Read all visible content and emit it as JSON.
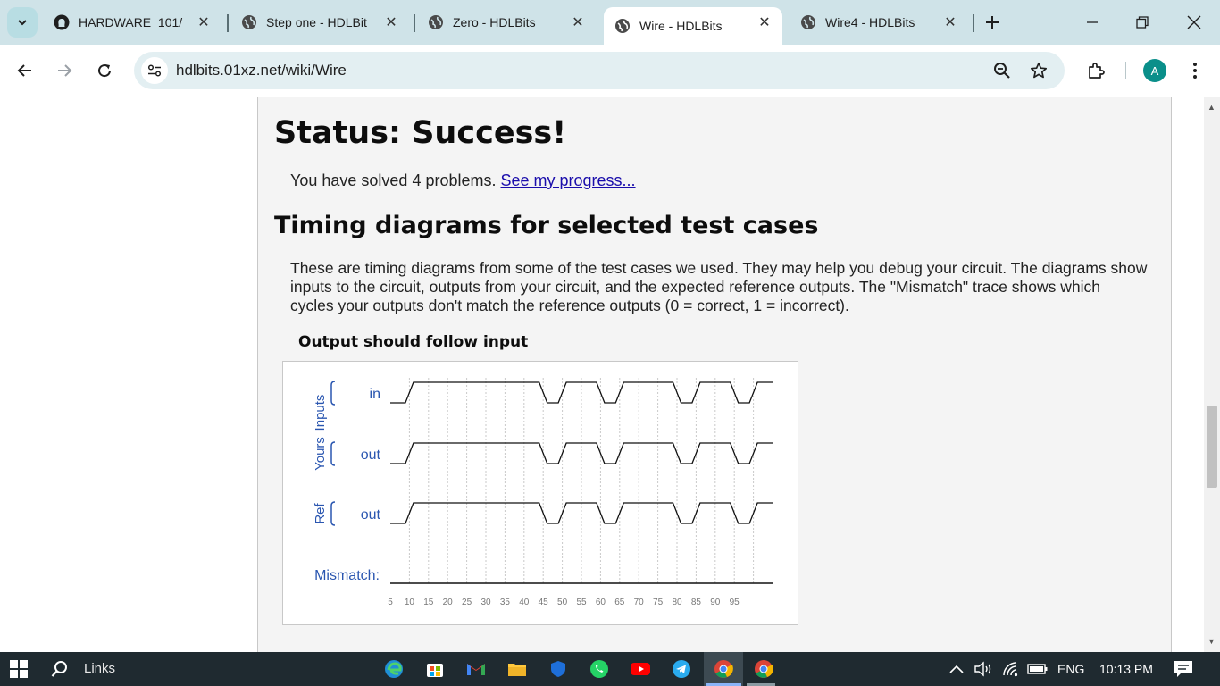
{
  "browser": {
    "tabs": [
      {
        "title": "HARDWARE_101/",
        "favicon": "github-icon"
      },
      {
        "title": "Step one - HDLBit",
        "favicon": "globe-icon"
      },
      {
        "title": "Zero - HDLBits",
        "favicon": "globe-icon"
      },
      {
        "title": "Wire - HDLBits",
        "favicon": "globe-icon",
        "active": true
      },
      {
        "title": "Wire4 - HDLBits",
        "favicon": "globe-icon"
      }
    ],
    "url": "hdlbits.01xz.net/wiki/Wire",
    "profile_initial": "A"
  },
  "page": {
    "status_heading": "Status: Success!",
    "solved_text": "You have solved 4 problems.",
    "progress_link": "See my progress...",
    "timing_heading": "Timing diagrams for selected test cases",
    "description": "These are timing diagrams from some of the test cases we used. They may help you debug your circuit. The diagrams show inputs to the circuit, outputs from your circuit, and the expected reference outputs. The \"Mismatch\" trace shows which cycles your outputs don't match the reference outputs (0 = correct, 1 = incorrect).",
    "diagram_title": "Output should follow input"
  },
  "timing": {
    "groups": [
      {
        "group": "Inputs",
        "signal": "in"
      },
      {
        "group": "Yours",
        "signal": "out"
      },
      {
        "group": "Ref",
        "signal": "out"
      }
    ],
    "mismatch_label": "Mismatch:",
    "ticks": [
      "5",
      "10",
      "15",
      "20",
      "25",
      "30",
      "35",
      "40",
      "45",
      "50",
      "55",
      "60",
      "65",
      "70",
      "75",
      "80",
      "85",
      "90",
      "95"
    ],
    "waveform_levels": [
      0,
      1,
      1,
      1,
      1,
      1,
      1,
      1,
      0,
      1,
      1,
      0,
      1,
      1,
      1,
      0,
      1,
      1,
      0,
      1
    ],
    "mismatch_levels": [
      0,
      0,
      0,
      0,
      0,
      0,
      0,
      0,
      0,
      0,
      0,
      0,
      0,
      0,
      0,
      0,
      0,
      0,
      0,
      0
    ],
    "label_color": "#2a56b0"
  },
  "taskbar": {
    "search_label": "Links",
    "language": "ENG",
    "time": "10:13 PM"
  }
}
